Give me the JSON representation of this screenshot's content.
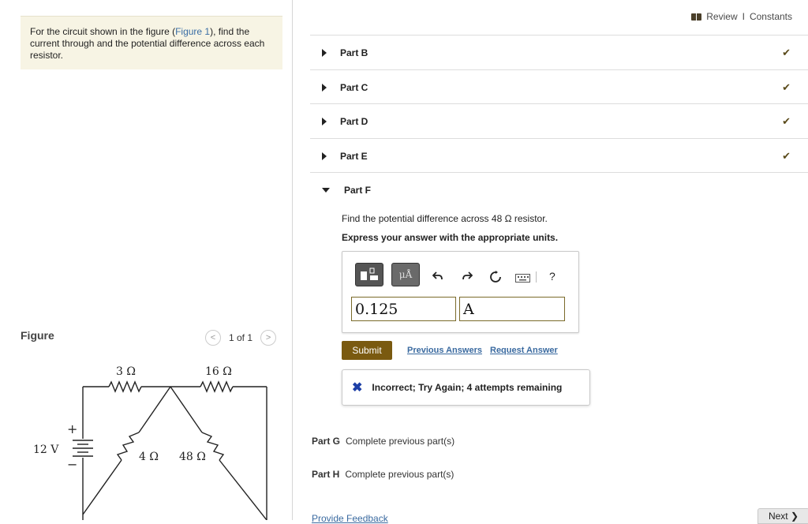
{
  "problem": {
    "text_before": "For the circuit shown in the figure (",
    "figure_link": "Figure 1",
    "text_after": "), find the current through and the potential difference across each resistor."
  },
  "figure": {
    "label": "Figure",
    "pager": "1 of 1",
    "prev_glyph": "<",
    "next_glyph": ">",
    "labels": {
      "r1": "3 Ω",
      "r2": "16 Ω",
      "r3": "4 Ω",
      "r4": "48 Ω",
      "battery": "12 V",
      "plus": "+",
      "minus": "−"
    }
  },
  "header": {
    "review": "Review",
    "separator": "I",
    "constants": "Constants"
  },
  "parts": [
    {
      "label": "Part B",
      "status": "complete"
    },
    {
      "label": "Part C",
      "status": "complete"
    },
    {
      "label": "Part D",
      "status": "complete"
    },
    {
      "label": "Part E",
      "status": "complete"
    },
    {
      "label": "Part F",
      "status": "open"
    }
  ],
  "check_glyph": "✔",
  "part_f": {
    "question": "Find the potential difference across 48 Ω resistor.",
    "instruction": "Express your answer with the appropriate units.",
    "toolbar": {
      "units_button": "μÅ",
      "help": "?"
    },
    "value": "0.125",
    "unit": "A",
    "submit_label": "Submit",
    "previous_answers": "Previous Answers",
    "request_answer": "Request Answer",
    "feedback_icon": "✖",
    "feedback": "Incorrect; Try Again; 4 attempts remaining"
  },
  "locked_parts": [
    {
      "label": "Part G",
      "text": "Complete previous part(s)"
    },
    {
      "label": "Part H",
      "text": "Complete previous part(s)"
    }
  ],
  "footer": {
    "provide_feedback": "Provide Feedback",
    "next": "Next ❯"
  },
  "colors": {
    "accent": "#7a5a10",
    "link": "#3a6aa0",
    "problem_bg": "#f7f4e4",
    "feedback_x": "#1d3fa6"
  }
}
